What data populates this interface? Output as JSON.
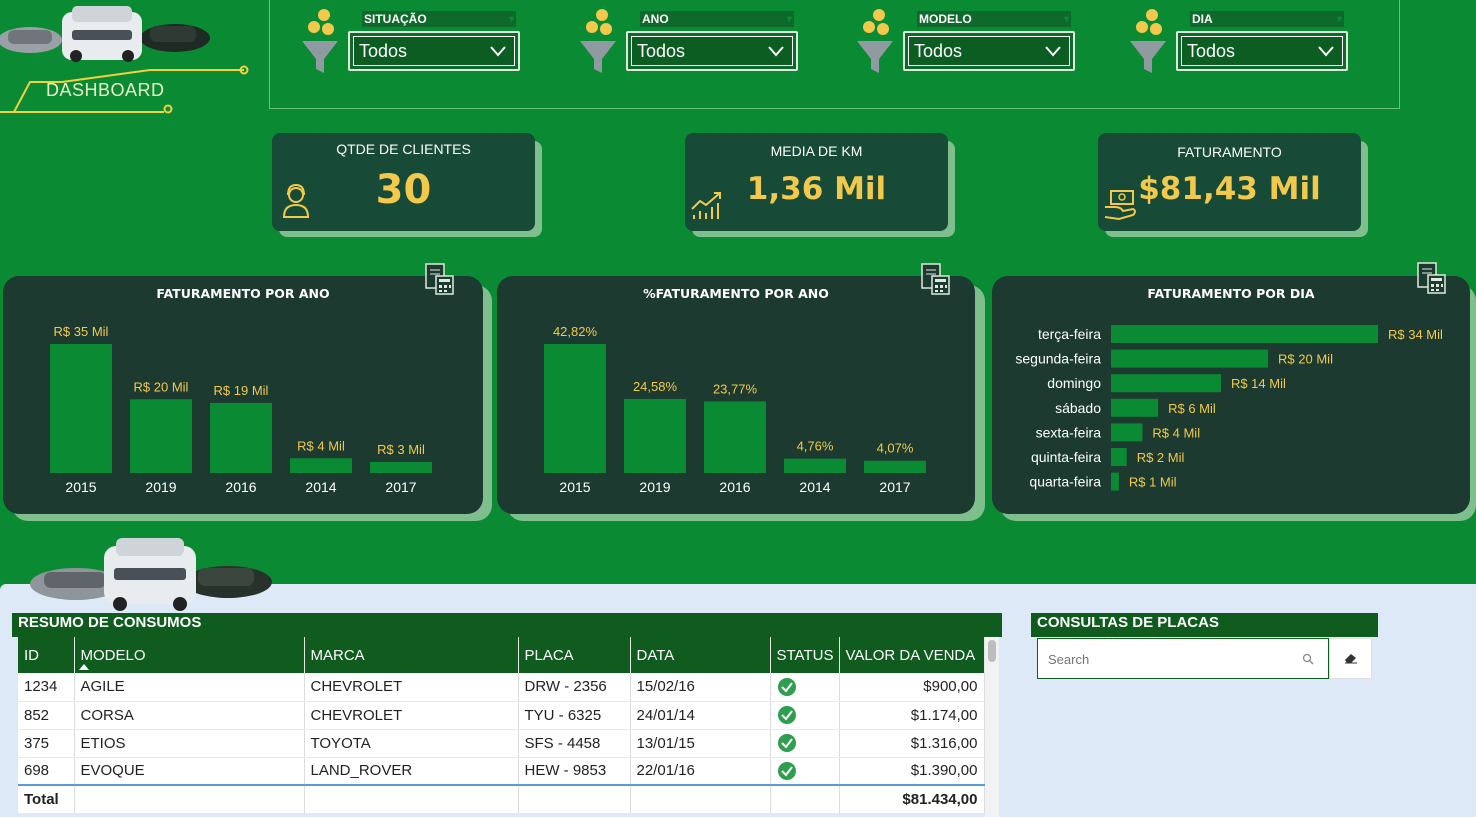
{
  "header": {
    "dashboard_label": "DASHBOARD"
  },
  "filters": [
    {
      "title": "SITUAÇÃO",
      "value": "Todos"
    },
    {
      "title": "ANO",
      "value": "Todos"
    },
    {
      "title": "MODELO",
      "value": "Todos"
    },
    {
      "title": "DIA",
      "value": "Todos"
    }
  ],
  "kpis": {
    "clientes": {
      "title": "QTDE DE CLIENTES",
      "value": "30"
    },
    "km": {
      "title": "MEDIA DE KM",
      "value": "1,36 Mil"
    },
    "faturamento": {
      "title": "FATURAMENTO",
      "value": "$81,43 Mil"
    }
  },
  "chart_data": [
    {
      "type": "bar",
      "title": "FATURAMENTO POR ANO",
      "categories": [
        "2015",
        "2019",
        "2016",
        "2014",
        "2017"
      ],
      "values": [
        35,
        20,
        19,
        4,
        3
      ],
      "data_labels": [
        "R$ 35 Mil",
        "R$ 20 Mil",
        "R$ 19 Mil",
        "R$ 4 Mil",
        "R$ 3 Mil"
      ],
      "ylim": [
        0,
        35
      ],
      "color": "#0b8a34"
    },
    {
      "type": "bar",
      "title": "%FATURAMENTO POR ANO",
      "categories": [
        "2015",
        "2019",
        "2016",
        "2014",
        "2017"
      ],
      "values": [
        42.82,
        24.58,
        23.77,
        4.76,
        4.07
      ],
      "data_labels": [
        "42,82%",
        "24,58%",
        "23,77%",
        "4,76%",
        "4,07%"
      ],
      "ylim": [
        0,
        42.82
      ],
      "color": "#0b8a34"
    },
    {
      "type": "bar",
      "orientation": "horizontal",
      "title": "FATURAMENTO POR DIA",
      "categories": [
        "terça-feira",
        "segunda-feira",
        "domingo",
        "sábado",
        "sexta-feira",
        "quinta-feira",
        "quarta-feira"
      ],
      "values": [
        34,
        20,
        14,
        6,
        4,
        2,
        1
      ],
      "data_labels": [
        "R$ 34 Mil",
        "R$ 20 Mil",
        "R$ 14 Mil",
        "R$ 6 Mil",
        "R$ 4 Mil",
        "R$ 2 Mil",
        "R$ 1 Mil"
      ],
      "xlim": [
        0,
        34
      ],
      "color": "#0b8a34"
    }
  ],
  "table": {
    "title": "RESUMO DE CONSUMOS",
    "columns": [
      "ID",
      "MODELO",
      "MARCA",
      "PLACA",
      "DATA",
      "STATUS",
      "VALOR DA VENDA"
    ],
    "sorted_column": "MODELO",
    "rows": [
      {
        "id": "1234",
        "modelo": "AGILE",
        "marca": "CHEVROLET",
        "placa": "DRW - 2356",
        "data": "15/02/16",
        "status": "check",
        "valor": "$900,00"
      },
      {
        "id": "852",
        "modelo": "CORSA",
        "marca": "CHEVROLET",
        "placa": "TYU - 6325",
        "data": "24/01/14",
        "status": "check",
        "valor": "$1.174,00"
      },
      {
        "id": "375",
        "modelo": "ETIOS",
        "marca": "TOYOTA",
        "placa": "SFS - 4458",
        "data": "13/01/15",
        "status": "check",
        "valor": "$1.316,00"
      },
      {
        "id": "698",
        "modelo": "EVOQUE",
        "marca": "LAND_ROVER",
        "placa": "HEW - 9853",
        "data": "22/01/16",
        "status": "check",
        "valor": "$1.390,00"
      }
    ],
    "total_label": "Total",
    "total_value": "$81.434,00"
  },
  "consultas": {
    "title": "CONSULTAS DE PLACAS",
    "search_placeholder": "Search"
  },
  "colors": {
    "background": "#0b8a34",
    "panel": "#1c3a30",
    "kpi": "#174a37",
    "accent_yellow": "#f2c94c",
    "table_header": "#0f5c1e"
  }
}
